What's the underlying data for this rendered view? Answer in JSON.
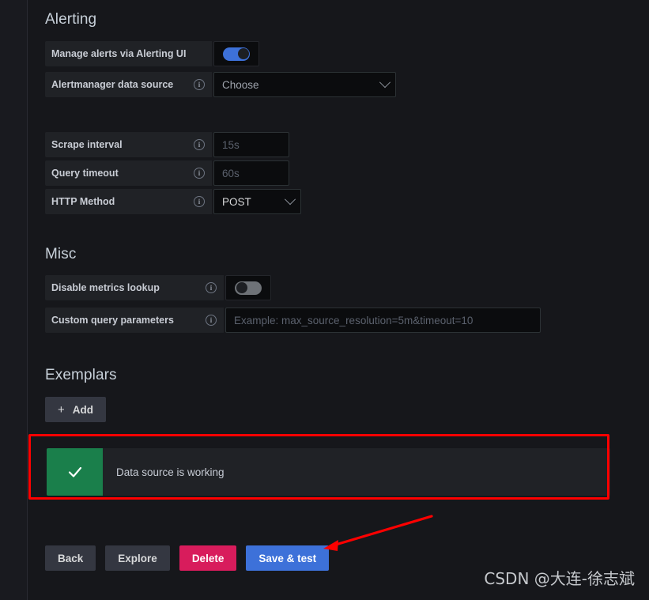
{
  "sections": {
    "alerting": {
      "title": "Alerting",
      "fields": {
        "manage_alerts": {
          "label": "Manage alerts via Alerting UI",
          "state": "on"
        },
        "alertmanager": {
          "label": "Alertmanager data source",
          "info_icon": "info-circle-icon",
          "value": "Choose",
          "chevron": "chevron-down-icon"
        }
      }
    },
    "intervals": {
      "scrape_interval": {
        "label": "Scrape interval",
        "info_icon": "info-circle-icon",
        "placeholder": "15s",
        "value": ""
      },
      "query_timeout": {
        "label": "Query timeout",
        "info_icon": "info-circle-icon",
        "placeholder": "60s",
        "value": ""
      },
      "http_method": {
        "label": "HTTP Method",
        "info_icon": "info-circle-icon",
        "value": "POST",
        "chevron": "chevron-down-icon"
      }
    },
    "misc": {
      "title": "Misc",
      "fields": {
        "disable_metrics_lookup": {
          "label": "Disable metrics lookup",
          "info_icon": "info-circle-icon",
          "state": "off"
        },
        "custom_query_parameters": {
          "label": "Custom query parameters",
          "info_icon": "info-circle-icon",
          "placeholder": "Example: max_source_resolution=5m&timeout=10",
          "value": ""
        }
      }
    },
    "exemplars": {
      "title": "Exemplars",
      "add_button": {
        "label": "Add",
        "icon": "plus-icon"
      }
    }
  },
  "alert": {
    "icon": "check-icon",
    "message": "Data source is working",
    "color": "#1a7f4b"
  },
  "footer_buttons": {
    "back": "Back",
    "explore": "Explore",
    "delete": "Delete",
    "save_and_test": "Save & test"
  },
  "annotations": {
    "highlight_color": "#fe0000",
    "arrow": "red-arrow"
  },
  "watermark": "CSDN @大连-徐志斌"
}
